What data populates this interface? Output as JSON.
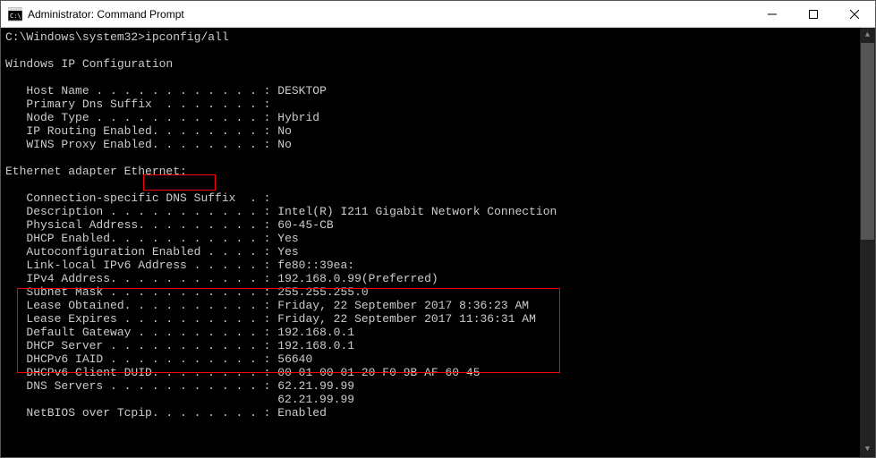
{
  "window": {
    "title": "Administrator: Command Prompt"
  },
  "terminal": {
    "prompt": "C:\\Windows\\system32>",
    "command": "ipconfig/all",
    "header": "Windows IP Configuration",
    "config": {
      "host_name": {
        "label": "Host Name . . . . . . . . . . . . :",
        "value": "DESKTOP"
      },
      "primary_dns": {
        "label": "Primary Dns Suffix  . . . . . . . :",
        "value": ""
      },
      "node_type": {
        "label": "Node Type . . . . . . . . . . . . :",
        "value": "Hybrid"
      },
      "ip_routing": {
        "label": "IP Routing Enabled. . . . . . . . :",
        "value": "No"
      },
      "wins_proxy": {
        "label": "WINS Proxy Enabled. . . . . . . . :",
        "value": "No"
      }
    },
    "adapter_header_prefix": "Ethernet adapter ",
    "adapter_header_name": "Ethernet:",
    "adapter": {
      "conn_suffix": {
        "label": "Connection-specific DNS Suffix  . :",
        "value": ""
      },
      "description": {
        "label": "Description . . . . . . . . . . . :",
        "value": "Intel(R) I211 Gigabit Network Connection"
      },
      "physical": {
        "label": "Physical Address. . . . . . . . . :",
        "value": "60-45-CB"
      },
      "dhcp_enabled": {
        "label": "DHCP Enabled. . . . . . . . . . . :",
        "value": "Yes"
      },
      "autoconfig": {
        "label": "Autoconfiguration Enabled . . . . :",
        "value": "Yes"
      },
      "link_local": {
        "label": "Link-local IPv6 Address . . . . . :",
        "value": "fe80::39ea:"
      },
      "ipv4": {
        "label": "IPv4 Address. . . . . . . . . . . :",
        "value": "192.168.0.99(Preferred)"
      },
      "subnet": {
        "label": "Subnet Mask . . . . . . . . . . . :",
        "value": "255.255.255.0"
      },
      "lease_obtained": {
        "label": "Lease Obtained. . . . . . . . . . :",
        "value": "Friday, 22 September 2017 8:36:23 AM"
      },
      "lease_expires": {
        "label": "Lease Expires . . . . . . . . . . :",
        "value": "Friday, 22 September 2017 11:36:31 AM"
      },
      "default_gw": {
        "label": "Default Gateway . . . . . . . . . :",
        "value": "192.168.0.1"
      },
      "dhcp_server": {
        "label": "DHCP Server . . . . . . . . . . . :",
        "value": "192.168.0.1"
      },
      "dhcpv6_iaid": {
        "label": "DHCPv6 IAID . . . . . . . . . . . :",
        "value": "56640"
      },
      "dhcpv6_duid": {
        "label": "DHCPv6 Client DUID. . . . . . . . :",
        "value": "00-01-00-01-20-F0-9B-AF-60-45"
      },
      "dns_servers": {
        "label": "DNS Servers . . . . . . . . . . . :",
        "value": "62.21.99.99"
      },
      "dns_servers2": "62.21.99.99",
      "netbios": {
        "label": "NetBIOS over Tcpip. . . . . . . . :",
        "value": "Enabled"
      }
    }
  }
}
